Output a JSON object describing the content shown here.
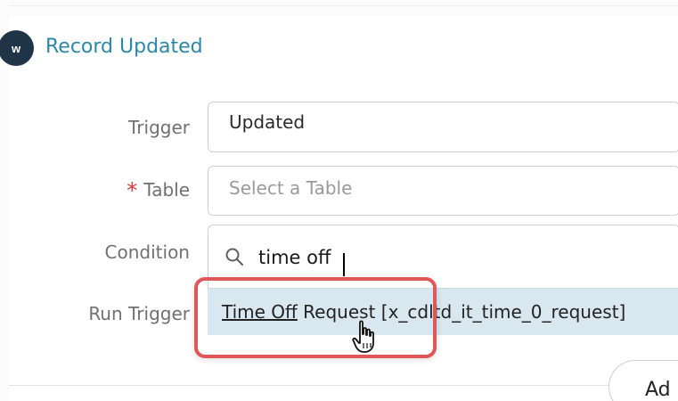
{
  "record": {
    "title": "Record Updated",
    "icon_text": "w"
  },
  "form": {
    "trigger": {
      "label": "Trigger",
      "value": "Updated"
    },
    "table": {
      "label": "Table",
      "required_mark": "*",
      "placeholder": "Select a Table"
    },
    "condition": {
      "label": "Condition"
    },
    "run_trigger": {
      "label": "Run Trigger"
    }
  },
  "search": {
    "value": "time off",
    "icon": "search-icon"
  },
  "dropdown": {
    "options": [
      {
        "match_text": "Time Off",
        "rest_text": " Request [x_cdltd_it_time_0_request]"
      }
    ]
  },
  "actions": {
    "add_label": "Ad"
  },
  "colors": {
    "accent": "#2b88a8",
    "required": "#d63a3a",
    "highlight_border": "#e05757",
    "option_bg": "#d8e7f0"
  },
  "icons": {
    "record": "record-icon",
    "search": "search-icon",
    "cursor": "hand-cursor-icon"
  }
}
